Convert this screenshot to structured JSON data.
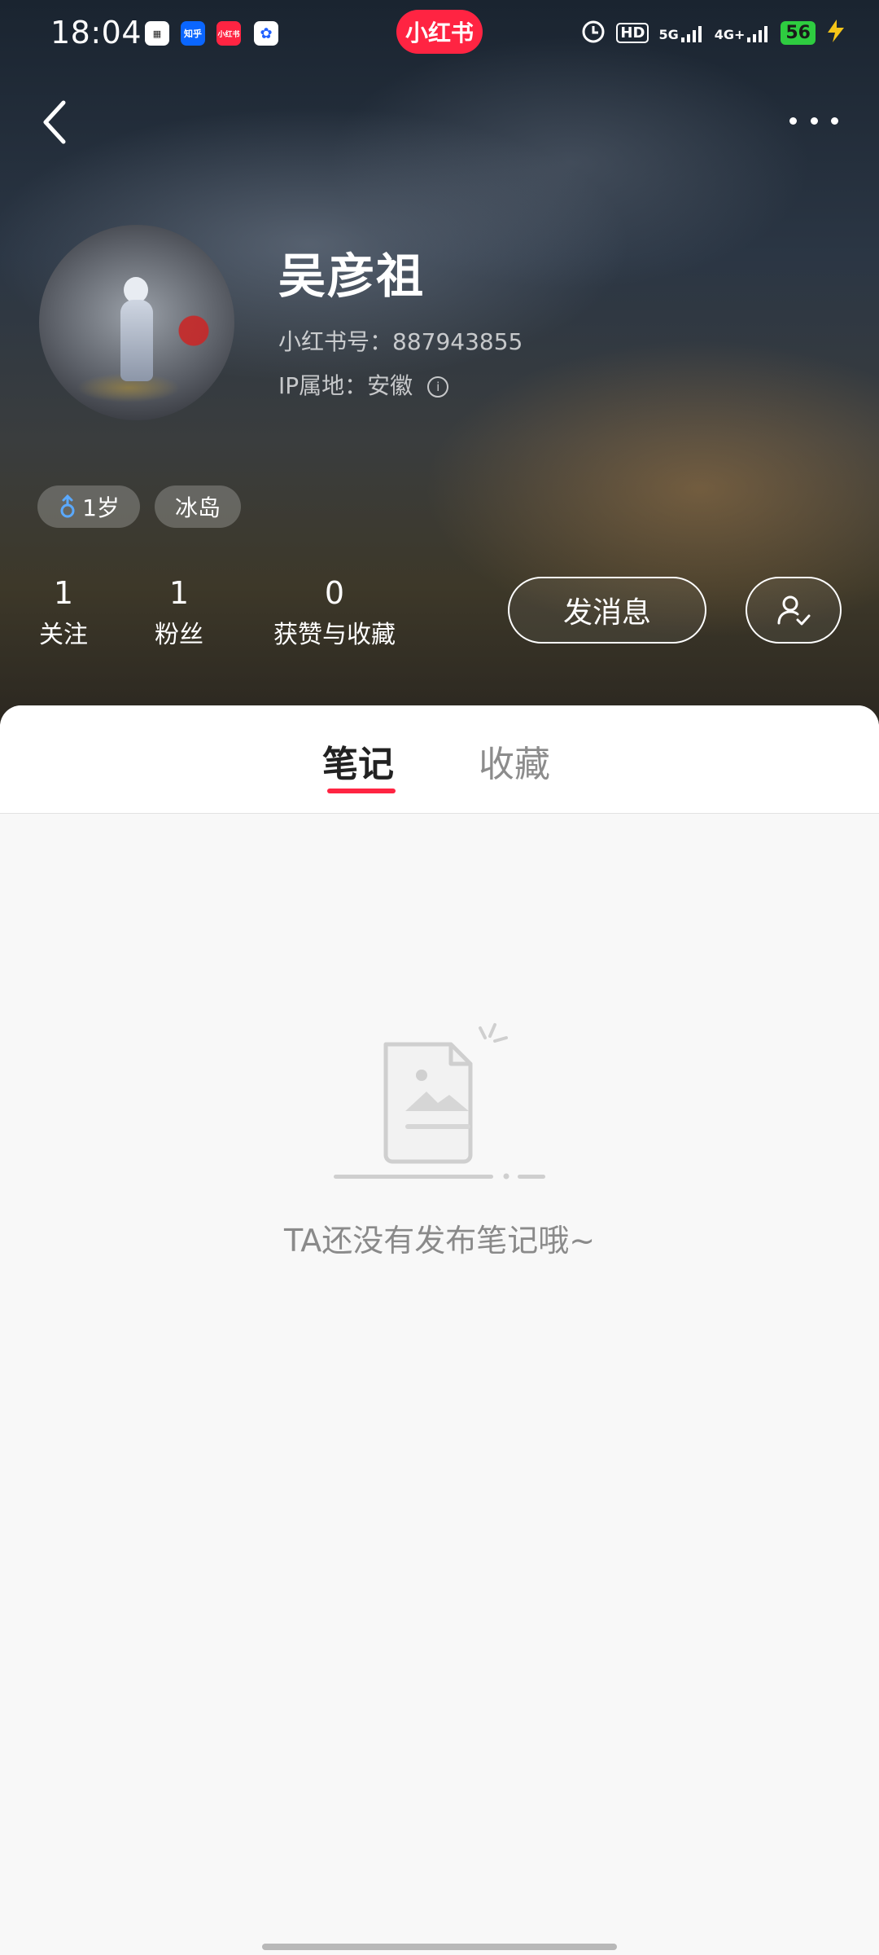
{
  "status_bar": {
    "time": "18:04",
    "app_badge": "小红书",
    "notification_icons": [
      "qr-app-icon",
      "zhihu-icon",
      "xiaohongshu-icon",
      "baidu-icon"
    ],
    "zhihu_label": "知乎",
    "xhs_small_label": "小红书",
    "indicators": [
      "alarm-icon",
      "hd-icon",
      "5g-signal-icon",
      "4g-signal-icon"
    ],
    "hd_label": "HD",
    "net1_label": "5G",
    "net2_label": "4G+",
    "battery": "56"
  },
  "header": {
    "back_icon": "chevron-left-icon",
    "more_icon": "more-dots-icon"
  },
  "profile": {
    "name": "吴彦祖",
    "id_line": "小红书号：887943855",
    "ip_line": "IP属地：安徽",
    "tags": [
      {
        "icon": "male-icon",
        "label": "1岁"
      },
      {
        "label": "冰岛"
      }
    ],
    "stats": [
      {
        "value": "1",
        "label": "关注"
      },
      {
        "value": "1",
        "label": "粉丝"
      },
      {
        "value": "0",
        "label": "获赞与收藏"
      }
    ],
    "message_button": "发消息",
    "follow_icon": "user-check-icon"
  },
  "tabs": [
    {
      "label": "笔记",
      "active": true
    },
    {
      "label": "收藏",
      "active": false
    }
  ],
  "empty_state": {
    "message": "TA还没有发布笔记哦~"
  },
  "colors": {
    "brand": "#ff2442",
    "tab_active": "#222222",
    "tab_inactive": "#8c8c8c",
    "empty_text": "#8a8a8a"
  }
}
